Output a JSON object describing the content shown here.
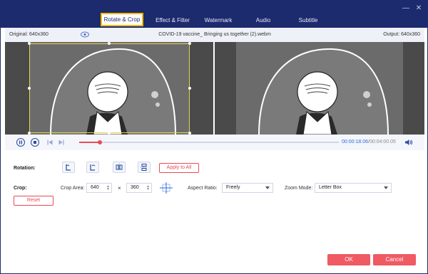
{
  "tabs": [
    {
      "label": "Rotate & Crop",
      "active": true
    },
    {
      "label": "Effect & Filter",
      "active": false
    },
    {
      "label": "Watermark",
      "active": false
    },
    {
      "label": "Audio",
      "active": false
    },
    {
      "label": "Subtitle",
      "active": false
    }
  ],
  "window_controls": {
    "minimize": "—",
    "close": "✕"
  },
  "infobar": {
    "original": "Original: 640x360",
    "filename": "COVID-19 vaccine_ Bringing us together (2).webm",
    "output": "Output: 640x360"
  },
  "playback": {
    "current_time": "00:00:18.06",
    "separator": "/",
    "duration": "00:04:00.05",
    "progress": 0.08
  },
  "rotation": {
    "label": "Rotation:",
    "apply_all": "Apply to All",
    "buttons": [
      "rotate-left-icon",
      "rotate-right-icon",
      "flip-horizontal-icon",
      "flip-vertical-icon"
    ]
  },
  "crop": {
    "label": "Crop:",
    "area_label": "Crop Area:",
    "width": "640",
    "times": "×",
    "height": "360",
    "aspect_label": "Aspect Ratio:",
    "aspect_value": "Freely",
    "zoom_label": "Zoom Mode:",
    "zoom_value": "Letter Box",
    "reset": "Reset"
  },
  "footer": {
    "ok": "OK",
    "cancel": "Cancel"
  },
  "colors": {
    "header": "#1c2a6e",
    "accent": "#ef5a63",
    "active_border": "#f5b800",
    "time": "#2a6bd8"
  }
}
